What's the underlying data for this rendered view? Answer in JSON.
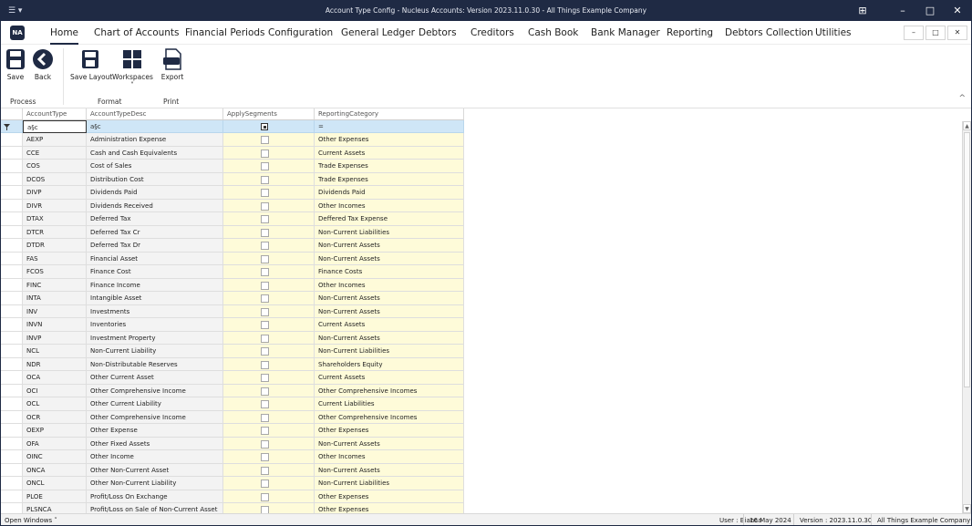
{
  "window": {
    "app_menu": "☰ ▾",
    "title": "Account Type Config - Nucleus Accounts: Version 2023.11.0.30 - All Things Example Company",
    "controls": [
      "⊞",
      "–",
      "□",
      "✕"
    ]
  },
  "menu": {
    "logo": "NA",
    "tabs": [
      "Home",
      "Chart of Accounts",
      "Financial Periods",
      "Configuration",
      "General Ledger",
      "Debtors",
      "Creditors",
      "Cash Book",
      "Bank Manager",
      "Reporting",
      "Debtors Collection",
      "Utilities"
    ],
    "mdi_controls": [
      "–",
      "□",
      "✕"
    ]
  },
  "ribbon": {
    "buttons": {
      "save": "Save",
      "back": "Back",
      "save_layout": "Save Layout",
      "workspaces": "Workspaces",
      "workspaces_caret": "˅",
      "export": "Export",
      "export_badge": "XLS"
    },
    "groups": {
      "process": "Process",
      "format": "Format",
      "print": "Print"
    },
    "collapse": "^"
  },
  "grid": {
    "columns": [
      "AccountType",
      "AccountTypeDesc",
      "ApplySegments",
      "ReportingCategory"
    ],
    "filter": {
      "type_value": "a§c",
      "desc_value": "a§c",
      "cat_value": "="
    },
    "rows": [
      {
        "type": "AEXP",
        "desc": "Administration Expense",
        "cat": "Other Expenses"
      },
      {
        "type": "CCE",
        "desc": "Cash and Cash Equivalents",
        "cat": "Current Assets"
      },
      {
        "type": "COS",
        "desc": "Cost of Sales",
        "cat": "Trade Expenses"
      },
      {
        "type": "DCOS",
        "desc": "Distribution Cost",
        "cat": "Trade Expenses"
      },
      {
        "type": "DIVP",
        "desc": "Dividends Paid",
        "cat": "Dividends Paid"
      },
      {
        "type": "DIVR",
        "desc": "Dividends Received",
        "cat": "Other Incomes"
      },
      {
        "type": "DTAX",
        "desc": "Deferred Tax",
        "cat": "Deffered Tax Expense"
      },
      {
        "type": "DTCR",
        "desc": "Deferred Tax Cr",
        "cat": "Non-Current Liabilities"
      },
      {
        "type": "DTDR",
        "desc": "Deferred Tax Dr",
        "cat": "Non-Current Assets"
      },
      {
        "type": "FAS",
        "desc": "Financial Asset",
        "cat": "Non-Current Assets"
      },
      {
        "type": "FCOS",
        "desc": "Finance Cost",
        "cat": "Finance Costs"
      },
      {
        "type": "FINC",
        "desc": "Finance Income",
        "cat": "Other Incomes"
      },
      {
        "type": "INTA",
        "desc": "Intangible Asset",
        "cat": "Non-Current Assets"
      },
      {
        "type": "INV",
        "desc": "Investments",
        "cat": "Non-Current Assets"
      },
      {
        "type": "INVN",
        "desc": "Inventories",
        "cat": "Current Assets"
      },
      {
        "type": "INVP",
        "desc": "Investment Property",
        "cat": "Non-Current Assets"
      },
      {
        "type": "NCL",
        "desc": "Non-Current Liability",
        "cat": "Non-Current Liabilities"
      },
      {
        "type": "NDR",
        "desc": "Non-Distributable Reserves",
        "cat": "Shareholders Equity"
      },
      {
        "type": "OCA",
        "desc": "Other Current Asset",
        "cat": "Current Assets"
      },
      {
        "type": "OCI",
        "desc": "Other Comprehensive Income",
        "cat": "Other Comprehensive Incomes"
      },
      {
        "type": "OCL",
        "desc": "Other Current Liability",
        "cat": "Current Liabilities"
      },
      {
        "type": "OCR",
        "desc": "Other Comprehensive Income",
        "cat": "Other Comprehensive Incomes"
      },
      {
        "type": "OEXP",
        "desc": "Other Expense",
        "cat": "Other Expenses"
      },
      {
        "type": "OFA",
        "desc": "Other Fixed Assets",
        "cat": "Non-Current Assets"
      },
      {
        "type": "OINC",
        "desc": "Other Income",
        "cat": "Other Incomes"
      },
      {
        "type": "ONCA",
        "desc": "Other Non-Current Asset",
        "cat": "Non-Current Assets"
      },
      {
        "type": "ONCL",
        "desc": "Other Non-Current Liability",
        "cat": "Non-Current Liabilities"
      },
      {
        "type": "PLOE",
        "desc": "Profit/Loss On Exchange",
        "cat": "Other Expenses"
      },
      {
        "type": "PLSNCA",
        "desc": "Profit/Loss on Sale of Non-Current Asset",
        "cat": "Other Expenses"
      }
    ]
  },
  "scrollbar": {
    "up": "▲",
    "down": "▼"
  },
  "status": {
    "open_windows": "Open Windows ˅",
    "user": "User : Bianca",
    "date": "16 May 2024",
    "version": "Version : 2023.11.0.30",
    "company": "All Things Example Company"
  },
  "colors": {
    "titlebar": "#1f2a44",
    "filter_row": "#cfe6f7",
    "editable_column": "#fefbd9",
    "readonly_column": "#f3f3f3"
  }
}
